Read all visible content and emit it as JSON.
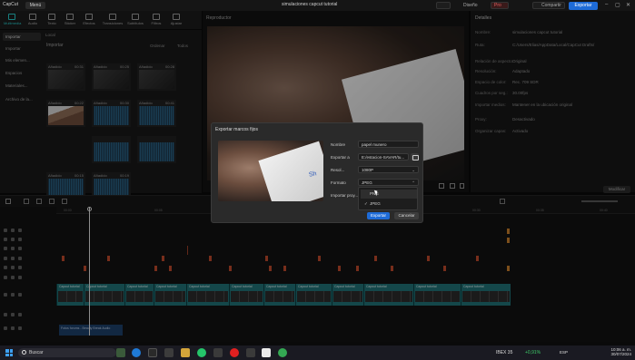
{
  "titlebar": {
    "app_name": "CapCut",
    "menu_label": "Menú",
    "project_title": "simulaciones capcut tutorial",
    "pro_label": "Pro",
    "share_label": "Compartir",
    "export_label": "Exportar"
  },
  "toolbar": {
    "items": [
      {
        "label": "Multimedia",
        "icon": "media-icon"
      },
      {
        "label": "Audio",
        "icon": "audio-icon"
      },
      {
        "label": "Texto",
        "icon": "text-icon"
      },
      {
        "label": "Sticker",
        "icon": "sticker-icon"
      },
      {
        "label": "Efectos",
        "icon": "effects-icon"
      },
      {
        "label": "Transiciones",
        "icon": "transitions-icon"
      },
      {
        "label": "Subtítulos",
        "icon": "captions-icon"
      },
      {
        "label": "Filtros",
        "icon": "filters-icon"
      },
      {
        "label": "Ajustar",
        "icon": "adjust-icon"
      }
    ]
  },
  "sidebar": {
    "items": [
      "Importar",
      "Importar",
      "Mis elemen...",
      "Espacios",
      "Materiales...",
      "Archivo de la..."
    ]
  },
  "media": {
    "top_label": "Local",
    "import_label": "Importar",
    "sort_label": "Ordenar",
    "all_label": "Todos",
    "thumbs": [
      {
        "label": "Añadido",
        "dur": "00:31",
        "kind": "video"
      },
      {
        "label": "Añadido",
        "dur": "00:25",
        "kind": "video"
      },
      {
        "label": "Añadido",
        "dur": "00:28",
        "kind": "video"
      },
      {
        "label": "Añadido",
        "dur": "00:22",
        "kind": "photo"
      },
      {
        "label": "Añadido",
        "dur": "00:30",
        "kind": "audio"
      },
      {
        "label": "Añadido",
        "dur": "00:41",
        "kind": "audio"
      },
      {
        "label": "",
        "dur": "",
        "kind": "audio"
      },
      {
        "label": "",
        "dur": "",
        "kind": "audio"
      },
      {
        "label": "Añadido",
        "dur": "00:15",
        "kind": "audio"
      },
      {
        "label": "Añadido",
        "dur": "00:19",
        "kind": "audio"
      }
    ]
  },
  "player": {
    "header": "Reproductor"
  },
  "details": {
    "header": "Detalles",
    "rows": [
      {
        "k": "Nombre:",
        "v": "simulaciones capcut tutorial"
      },
      {
        "k": "Ruta:",
        "v": "C:/Users/Elias/AppData/Local/CapCut Drafts/"
      },
      {
        "k": "Relación de aspecto:",
        "v": "Original"
      },
      {
        "k": "Resolución:",
        "v": "Adaptado"
      },
      {
        "k": "Espacio de color:",
        "v": "Rec. 709 SDR"
      },
      {
        "k": "Cuadros por seg.:",
        "v": "30.00fps"
      },
      {
        "k": "Importar medios:",
        "v": "Mantener en la ubicación original"
      },
      {
        "k": "Proxy:",
        "v": "Desactivado"
      },
      {
        "k": "Organizar capas:",
        "v": "Activado"
      }
    ],
    "modify_label": "Modificar"
  },
  "timeline": {
    "ticks": [
      "00:00",
      "00:05",
      "00:10",
      "00:15",
      "00:20",
      "00:25",
      "00:30",
      "00:35",
      "00:40"
    ],
    "video_clip_label": "Capcut tutorial",
    "audio_clip_label": "Fotos forums - Beauty Break Audio"
  },
  "dialog": {
    "title": "Exportar marcos fijos",
    "name_label": "Nombre",
    "name_value": "papel munero",
    "export_to_label": "Exportar a",
    "export_to_value": "E:/estacion-SAVAR/tu...",
    "resolution_label": "Resol...",
    "resolution_value": "1080P",
    "format_label": "Formato",
    "format_value": "JPEG",
    "import_project_label": "Importar proy...",
    "export_button": "Exportar",
    "cancel_button": "Cancelar",
    "format_options": [
      "PNG",
      "JPEG"
    ],
    "selected_option": "JPEG"
  },
  "taskbar": {
    "search_placeholder": "Buscar",
    "ibex_label": "IBEX 35",
    "ibex_value": "+0,91%",
    "lang": "ESP",
    "time": "10:06 a. m.",
    "date": "30/07/2024"
  }
}
